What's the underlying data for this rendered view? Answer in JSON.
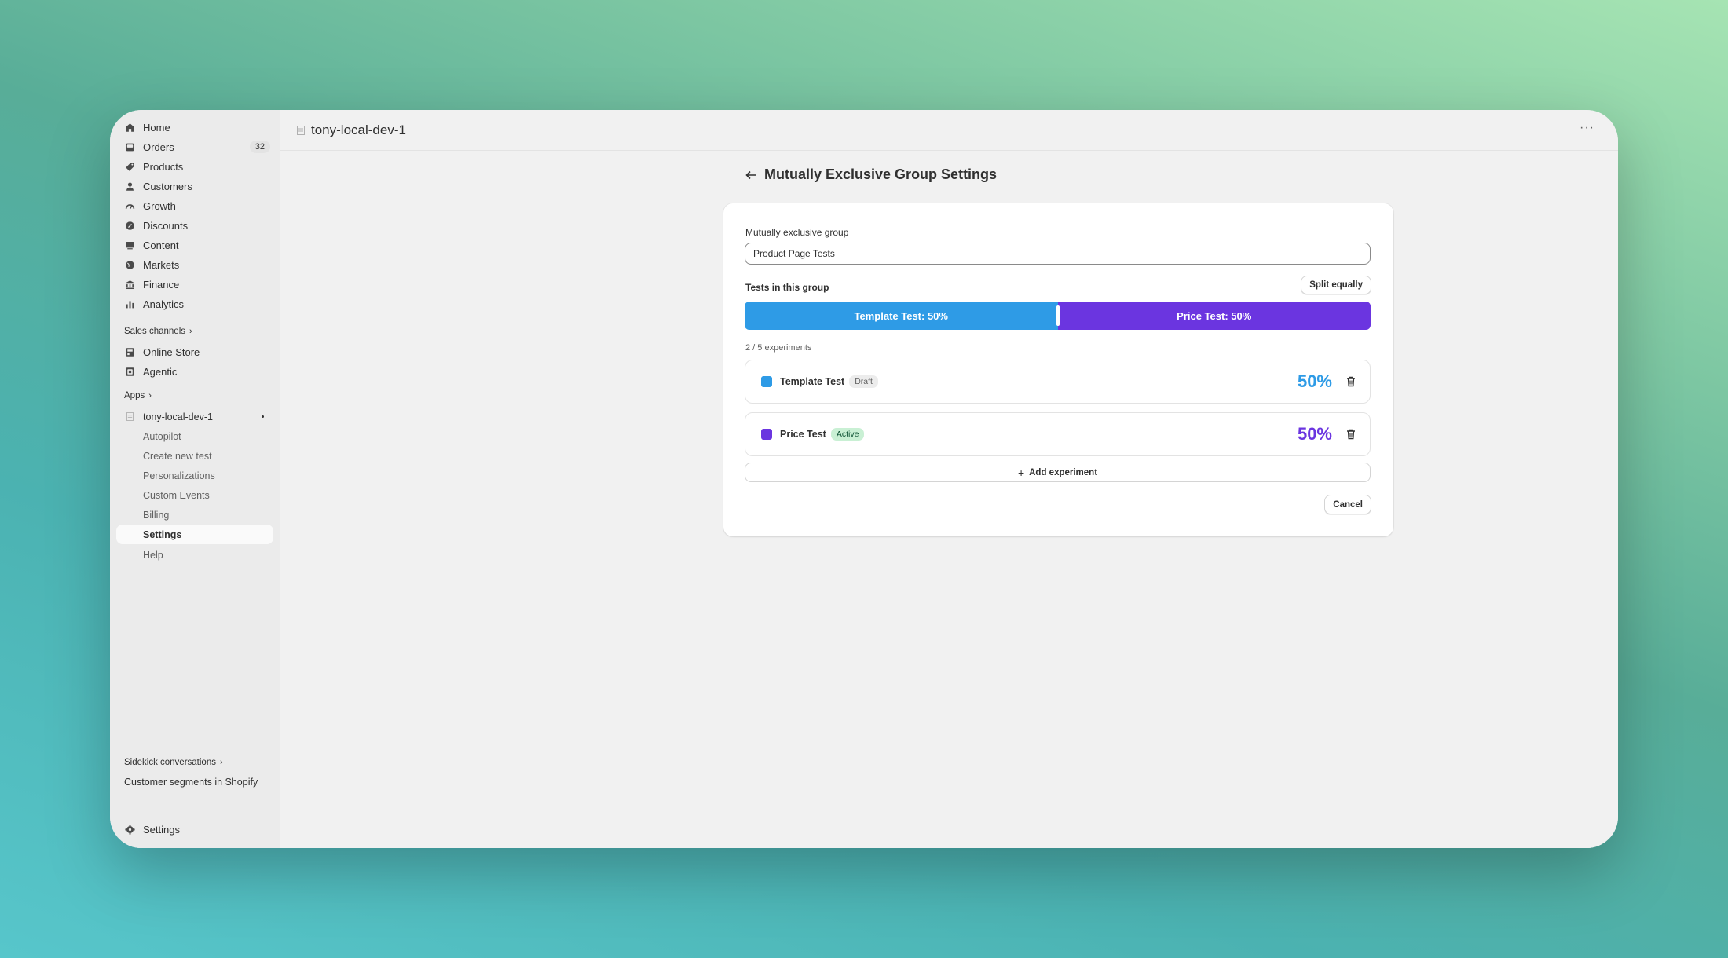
{
  "store": {
    "name": "tony-local-dev-1"
  },
  "sidebar": {
    "nav": [
      {
        "label": "Home",
        "icon": "home-icon"
      },
      {
        "label": "Orders",
        "icon": "inbox-icon",
        "badge": "32"
      },
      {
        "label": "Products",
        "icon": "tag-icon"
      },
      {
        "label": "Customers",
        "icon": "person-icon"
      },
      {
        "label": "Growth",
        "icon": "gauge-icon"
      },
      {
        "label": "Discounts",
        "icon": "discount-icon"
      },
      {
        "label": "Content",
        "icon": "content-icon"
      },
      {
        "label": "Markets",
        "icon": "globe-icon"
      },
      {
        "label": "Finance",
        "icon": "bank-icon"
      },
      {
        "label": "Analytics",
        "icon": "bar-chart-icon"
      }
    ],
    "sales_channels_label": "Sales channels",
    "sales_channels": [
      {
        "label": "Online Store",
        "icon": "store-icon"
      },
      {
        "label": "Agentic",
        "icon": "agentic-icon"
      }
    ],
    "apps_label": "Apps",
    "app": {
      "name": "tony-local-dev-1",
      "items": [
        "Autopilot",
        "Create new test",
        "Personalizations",
        "Custom Events",
        "Billing",
        "Settings"
      ],
      "active_item": "Settings",
      "help": "Help"
    },
    "sidekick_label": "Sidekick conversations",
    "sidekick_item": "Customer segments in Shopify",
    "settings_label": "Settings"
  },
  "page": {
    "title": "Mutually Exclusive Group Settings",
    "group_label": "Mutually exclusive group",
    "group_value": "Product Page Tests",
    "tests_label": "Tests in this group",
    "split_button": "Split equally",
    "split_segments": [
      {
        "label": "Template Test: 50%",
        "share": 0.5,
        "color": "#2e9be6"
      },
      {
        "label": "Price Test: 50%",
        "share": 0.5,
        "color": "#6b35e0"
      }
    ],
    "experiments_count": "2 / 5 experiments",
    "experiments": [
      {
        "name": "Template Test",
        "status": "Draft",
        "percent": "50%",
        "color": "#2e9be6"
      },
      {
        "name": "Price Test",
        "status": "Active",
        "percent": "50%",
        "color": "#6b35e0"
      }
    ],
    "add_button": "Add experiment",
    "cancel_button": "Cancel"
  }
}
